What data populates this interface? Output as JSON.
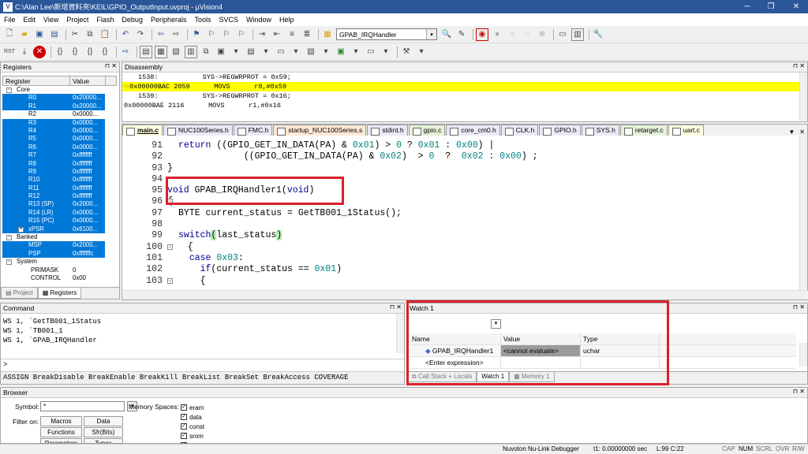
{
  "window": {
    "title": "C:\\Alan Lee\\新增資料夾\\KEIL\\GPIO_OutputInput.uvproj - µVision4"
  },
  "menu": [
    "File",
    "Edit",
    "View",
    "Project",
    "Flash",
    "Debug",
    "Peripherals",
    "Tools",
    "SVCS",
    "Window",
    "Help"
  ],
  "toolbar": {
    "function_combo": "GPAB_IRQHandler"
  },
  "registers": {
    "title": "Registers",
    "col_register": "Register",
    "col_value": "Value",
    "core_label": "Core",
    "rows": [
      {
        "name": "R0",
        "value": "0x20000..."
      },
      {
        "name": "R1",
        "value": "0x20000..."
      },
      {
        "name": "R2",
        "value": "0x0000..."
      },
      {
        "name": "R3",
        "value": "0x0000..."
      },
      {
        "name": "R4",
        "value": "0x0000..."
      },
      {
        "name": "R5",
        "value": "0x0000..."
      },
      {
        "name": "R6",
        "value": "0x0000..."
      },
      {
        "name": "R7",
        "value": "0xffffffff"
      },
      {
        "name": "R8",
        "value": "0xffffffff"
      },
      {
        "name": "R9",
        "value": "0xffffffff"
      },
      {
        "name": "R10",
        "value": "0xffffffff"
      },
      {
        "name": "R11",
        "value": "0xffffffff"
      },
      {
        "name": "R12",
        "value": "0xffffffff"
      },
      {
        "name": "R13 (SP)",
        "value": "0x2000..."
      },
      {
        "name": "R14 (LR)",
        "value": "0x0000..."
      },
      {
        "name": "R15 (PC)",
        "value": "0x0000..."
      },
      {
        "name": "xPSR",
        "value": "0x6100..."
      }
    ],
    "banked_label": "Banked",
    "banked": [
      {
        "name": "MSP",
        "value": "0x2000..."
      },
      {
        "name": "PSP",
        "value": "0xfffffffc"
      }
    ],
    "system_label": "System",
    "system": [
      {
        "name": "PRIMASK",
        "value": "0"
      },
      {
        "name": "CONTROL",
        "value": "0x00"
      }
    ],
    "tab_project": "Project",
    "tab_registers": "Registers"
  },
  "disassembly": {
    "title": "Disassembly",
    "lines": [
      "1538:           SYS->REGWRPROT = 0x59;",
      "0x00000BAC 2059      MOVS      r0,#0x59",
      "1539:           SYS->REGWRPROT = 0x16;",
      "0x00000BAE 2116      MOVS      r1,#0x16"
    ]
  },
  "editor": {
    "tabs": [
      "main.c",
      "NUC100Series.h",
      "FMC.h",
      "startup_NUC100Series.s",
      "stdint.h",
      "gpio.c",
      "core_cm0.h",
      "CLK.h",
      "GPIO.h",
      "SYS.h",
      "retarget.c",
      "uart.c"
    ],
    "lines": [
      {
        "n": "91",
        "code": "  return ((GPIO_GET_IN_DATA(PA) & 0x01) > 0 ? 0x01 : 0x00) |"
      },
      {
        "n": "92",
        "code": "              ((GPIO_GET_IN_DATA(PA) & 0x02)  > 0  ?  0x02 : 0x00) ;"
      },
      {
        "n": "93",
        "code": "}"
      },
      {
        "n": "94",
        "code": ""
      },
      {
        "n": "95",
        "code": "void GPAB_IRQHandler1(void)"
      },
      {
        "n": "96",
        "code": "{"
      },
      {
        "n": "97",
        "code": "  BYTE current_status = GetTB001_1Status();"
      },
      {
        "n": "98",
        "code": ""
      },
      {
        "n": "99",
        "code": "  switch(last_status)"
      },
      {
        "n": "100",
        "code": "  {"
      },
      {
        "n": "101",
        "code": "    case 0x03:"
      },
      {
        "n": "102",
        "code": "      if(current_status == 0x01)"
      },
      {
        "n": "103",
        "code": "      {"
      }
    ]
  },
  "command": {
    "title": "Command",
    "lines": [
      "WS 1, `GetTB001_1Status",
      "WS 1, `TB001_1",
      "WS 1, `GPAB_IRQHandler"
    ],
    "prompt": ">",
    "hint": "ASSIGN BreakDisable BreakEnable BreakKill BreakList BreakSet BreakAccess COVERAGE"
  },
  "watch": {
    "title": "Watch 1",
    "col_name": "Name",
    "col_value": "Value",
    "col_type": "Type",
    "rows": [
      {
        "name": "GPAB_IRQHandler1",
        "value": "<cannot evaluate>",
        "type": "uchar"
      },
      {
        "name": "<Enter expression>",
        "value": "",
        "type": ""
      }
    ],
    "tabs": [
      "Call Stack + Locals",
      "Watch 1",
      "Memory 1"
    ]
  },
  "browser": {
    "title": "Browser",
    "symbol_label": "Symbol:",
    "symbol_value": "*",
    "filter_label": "Filter on:",
    "buttons": [
      "Macros",
      "Data",
      "Functions",
      "Sfr(Bits)",
      "Parameters",
      "Types"
    ],
    "memory_label": "Memory Spaces:",
    "spaces": [
      "eram",
      "data",
      "const",
      "srom",
      "sram"
    ]
  },
  "status": {
    "debugger": "Nuvoton Nu-Link Debugger",
    "time": "t1: 0.00000000 sec",
    "pos": "L:99 C:22",
    "cap": "CAP",
    "num": "NUM",
    "scrl": "SCRL",
    "ovr": "OVR",
    "rw": "R/W"
  }
}
